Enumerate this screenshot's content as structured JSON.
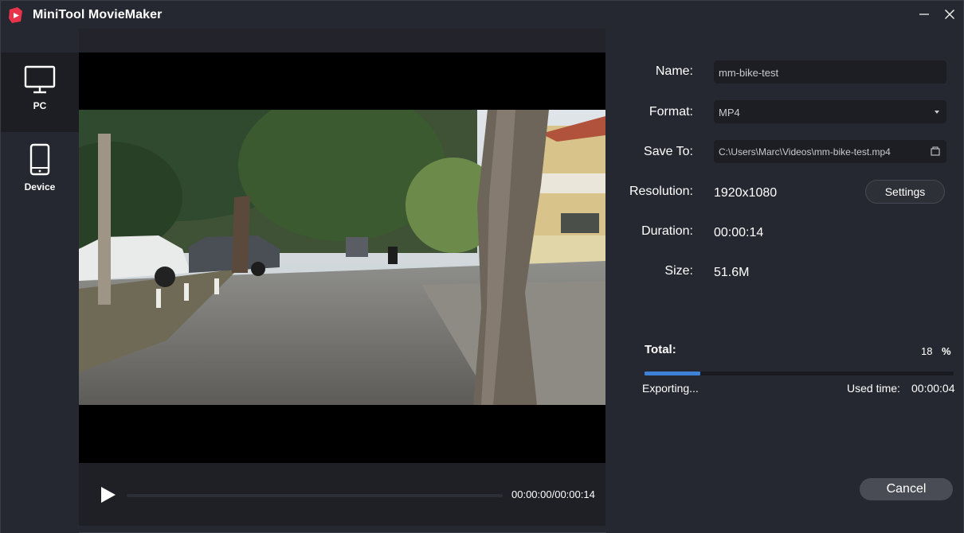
{
  "app": {
    "title": "MiniTool MovieMaker",
    "accent_color": "#e8334a"
  },
  "sidebar": {
    "items": [
      {
        "label": "PC",
        "icon": "monitor-icon",
        "active": true
      },
      {
        "label": "Device",
        "icon": "phone-icon",
        "active": false
      }
    ]
  },
  "player": {
    "time": "00:00:00/00:00:14",
    "position_fraction": 0.0
  },
  "export": {
    "name_label": "Name:",
    "name_value": "mm-bike-test",
    "format_label": "Format:",
    "format_value": "MP4",
    "save_label": "Save To:",
    "save_value": "C:\\Users\\Marc\\Videos\\mm-bike-test.mp4",
    "resolution_label": "Resolution:",
    "resolution_value": "1920x1080",
    "settings_label": "Settings",
    "duration_label": "Duration:",
    "duration_value": "00:00:14",
    "size_label": "Size:",
    "size_value": "51.6M"
  },
  "progress": {
    "total_label": "Total:",
    "percent": "18",
    "percent_sign": "%",
    "fraction": 0.18,
    "status": "Exporting...",
    "used_label": "Used time:",
    "used_value": "00:00:04",
    "fill_color": "#3d82d6"
  },
  "cancel_label": "Cancel"
}
